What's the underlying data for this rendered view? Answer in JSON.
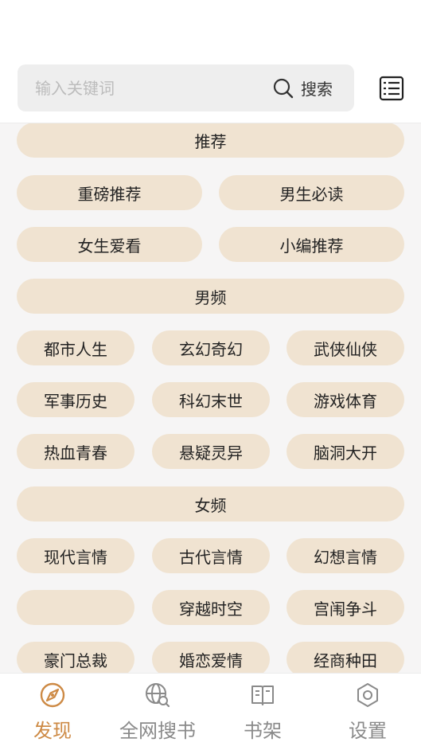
{
  "search": {
    "placeholder": "输入关键词",
    "button_label": "搜索"
  },
  "sections": [
    {
      "title": "推荐",
      "items": [
        "重磅推荐",
        "男生必读",
        "女生爱看",
        "小编推荐"
      ]
    },
    {
      "title": "男频",
      "items": [
        "都市人生",
        "玄幻奇幻",
        "武侠仙侠",
        "军事历史",
        "科幻末世",
        "游戏体育",
        "热血青春",
        "悬疑灵异",
        "脑洞大开"
      ]
    },
    {
      "title": "女频",
      "items": [
        "现代言情",
        "古代言情",
        "幻想言情",
        "",
        "穿越时空",
        "宫闱争斗",
        "豪门总裁",
        "婚恋爱情",
        "经商种田"
      ]
    }
  ],
  "nav": [
    {
      "label": "发现",
      "icon": "compass-icon",
      "active": true
    },
    {
      "label": "全网搜书",
      "icon": "globe-search-icon",
      "active": false
    },
    {
      "label": "书架",
      "icon": "book-icon",
      "active": false
    },
    {
      "label": "设置",
      "icon": "settings-gear-icon",
      "active": false
    }
  ],
  "colors": {
    "accent": "#cd8a45",
    "chip_bg": "#f0e3d1",
    "content_bg": "#f6f5f5",
    "inactive": "#8a8a8a"
  }
}
